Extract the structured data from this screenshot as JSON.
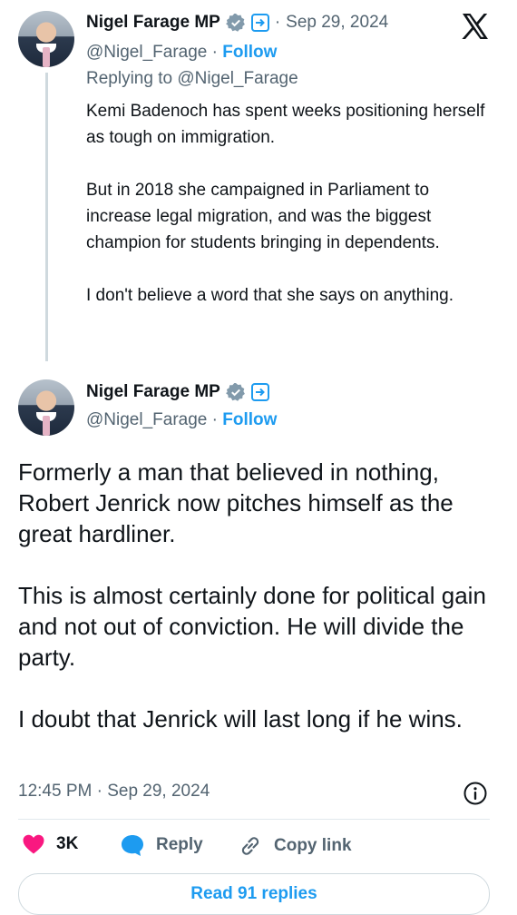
{
  "parent_tweet": {
    "author_name": "Nigel Farage MP",
    "handle": "@Nigel_Farage",
    "separator": "·",
    "follow_label": "Follow",
    "date": "Sep 29, 2024",
    "replying_to": "Replying to @Nigel_Farage",
    "paragraphs": [
      "Kemi Badenoch has spent weeks positioning herself as tough on immigration.",
      "But in 2018 she campaigned in Parliament to increase legal migration, and was the biggest champion for students bringing in dependents.",
      "I don't believe a word that she says on anything."
    ]
  },
  "main_tweet": {
    "author_name": "Nigel Farage MP",
    "handle": "@Nigel_Farage",
    "separator": "·",
    "follow_label": "Follow",
    "paragraphs": [
      "Formerly a man that believed in nothing, Robert Jenrick now pitches himself as the great hardliner.",
      "This is almost certainly done for political gain and not out of conviction. He will divide the party.",
      "I doubt that Jenrick will last long if he wins."
    ],
    "timestamp": "12:45 PM · Sep 29, 2024"
  },
  "actions": {
    "like_count": "3K",
    "reply_label": "Reply",
    "copy_link_label": "Copy link"
  },
  "read_replies_label": "Read 91 replies",
  "icons": {
    "brand": "x-logo-icon",
    "verified": "verified-badge-icon",
    "affiliate": "affiliate-badge-icon",
    "info": "info-icon",
    "like": "heart-icon",
    "reply": "reply-bubble-icon",
    "copy_link": "link-icon"
  },
  "colors": {
    "accent": "#1d9bf0",
    "like": "#f91880",
    "text": "#0f1419",
    "muted": "#536471"
  }
}
